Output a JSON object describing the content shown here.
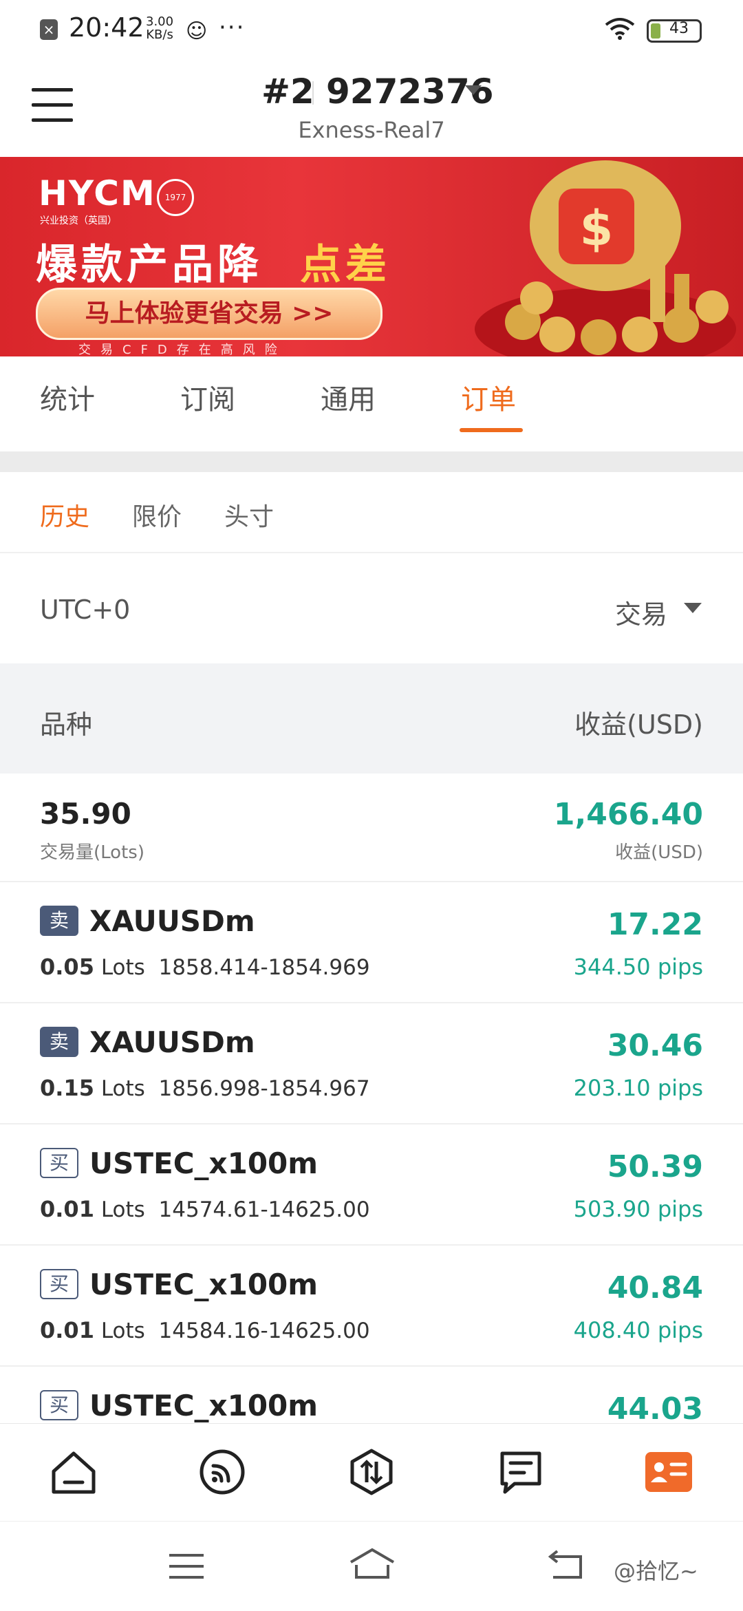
{
  "status_bar": {
    "time": "20:42",
    "net_speed_top": "3.00",
    "net_speed_bottom": "KB/s",
    "dots": "···",
    "battery": "43"
  },
  "header": {
    "account_num": "#2",
    "account_id": "9272376",
    "server": "Exness-Real7"
  },
  "banner": {
    "brand": "HYCM",
    "brand_sub": "兴业投资（英国）",
    "seal_text": "始于1977",
    "headline_white": "爆款产品降",
    "headline_gold": "点差",
    "button": "马上体验更省交易 >>",
    "risk": "交易CFD存在高风险"
  },
  "tabs": [
    {
      "label": "统计"
    },
    {
      "label": "订阅"
    },
    {
      "label": "通用"
    },
    {
      "label": "订单"
    }
  ],
  "subtabs": [
    {
      "label": "历史"
    },
    {
      "label": "限价"
    },
    {
      "label": "头寸"
    }
  ],
  "filter": {
    "timezone": "UTC+0",
    "type": "交易"
  },
  "table_header": {
    "left": "品种",
    "right": "收益(USD)"
  },
  "summary": {
    "lots": "35.90",
    "lots_label": "交易量(Lots)",
    "profit": "1,466.40",
    "profit_label": "收益(USD)"
  },
  "orders": [
    {
      "side": "卖",
      "symbol": "XAUUSDm",
      "lots": "0.05",
      "lots_unit": "Lots",
      "range": "1858.414-1854.969",
      "profit": "17.22",
      "pips": "344.50 pips"
    },
    {
      "side": "卖",
      "symbol": "XAUUSDm",
      "lots": "0.15",
      "lots_unit": "Lots",
      "range": "1856.998-1854.967",
      "profit": "30.46",
      "pips": "203.10 pips"
    },
    {
      "side": "买",
      "symbol": "USTEC_x100m",
      "lots": "0.01",
      "lots_unit": "Lots",
      "range": "14574.61-14625.00",
      "profit": "50.39",
      "pips": "503.90 pips"
    },
    {
      "side": "买",
      "symbol": "USTEC_x100m",
      "lots": "0.01",
      "lots_unit": "Lots",
      "range": "14584.16-14625.00",
      "profit": "40.84",
      "pips": "408.40 pips"
    },
    {
      "side": "买",
      "symbol": "USTEC_x100m",
      "profit": "44.03"
    }
  ],
  "bottom_nav": [
    {
      "icon": "home-icon"
    },
    {
      "icon": "signal-icon"
    },
    {
      "icon": "trade-icon"
    },
    {
      "icon": "news-icon"
    },
    {
      "icon": "profile-card-icon"
    }
  ],
  "watermark": "@拾忆~",
  "colors": {
    "accent": "#ef6b1d",
    "profit": "#1aa58c",
    "badge": "#4b5a78",
    "banner_red": "#d9262b"
  }
}
